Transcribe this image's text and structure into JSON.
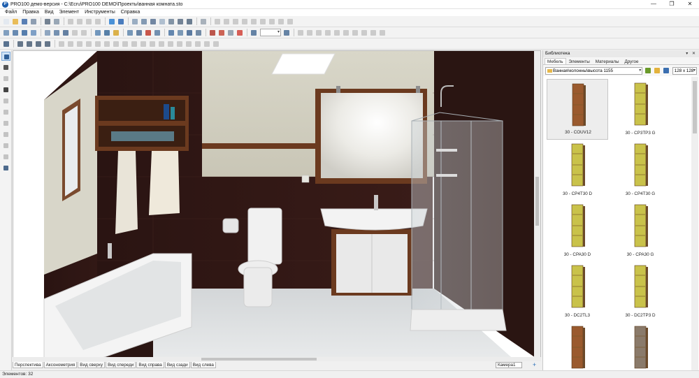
{
  "window": {
    "title": "PRO100 демо-версия - C:\\Ecru\\PRO100 DEMO\\Проекты\\ванная комната.sto",
    "app_icon_letter": "P",
    "minimize": "—",
    "maximize": "❐",
    "close": "✕"
  },
  "menu": [
    "Файл",
    "Правка",
    "Вид",
    "Элемент",
    "Инструменты",
    "Справка"
  ],
  "toolbar": {
    "zoom_value": ""
  },
  "view_tabs": [
    {
      "label": "Перспектива",
      "active": true
    },
    {
      "label": "Аксонометрия"
    },
    {
      "label": "Вид сверху"
    },
    {
      "label": "Вид спереди"
    },
    {
      "label": "Вид справа"
    },
    {
      "label": "Вид сзади"
    },
    {
      "label": "Вид слева"
    }
  ],
  "camera": {
    "label": "Камера1",
    "add": "+"
  },
  "status": {
    "text": "Элементов: 32"
  },
  "library": {
    "title": "Библиотека",
    "header_controls": "▾ ✕",
    "tabs": [
      {
        "label": "Мебель",
        "active": true
      },
      {
        "label": "Элементы"
      },
      {
        "label": "Материалы"
      },
      {
        "label": "Другое"
      }
    ],
    "path": "Ванная\\колонны\\высота 1155",
    "thumb_size": "128 x 128",
    "items": [
      {
        "label": "30 - COUV12",
        "color": "#9a5a2e",
        "selected": true
      },
      {
        "label": "30 - CP3TP3 G",
        "color": "#c9c24a"
      },
      {
        "label": "30 - CP4T30 D",
        "color": "#c9c24a"
      },
      {
        "label": "30 - CP4T30 G",
        "color": "#c9c24a"
      },
      {
        "label": "30 - CPA30 D",
        "color": "#c9c24a"
      },
      {
        "label": "30 - CPA30 G",
        "color": "#c9c24a"
      },
      {
        "label": "30 - DC2TL3",
        "color": "#c9c24a"
      },
      {
        "label": "30 - DC2TP3 D",
        "color": "#c9c24a"
      },
      {
        "label": "",
        "color": "#9a5a2e"
      },
      {
        "label": "",
        "color": "#8a7a6a"
      }
    ]
  }
}
